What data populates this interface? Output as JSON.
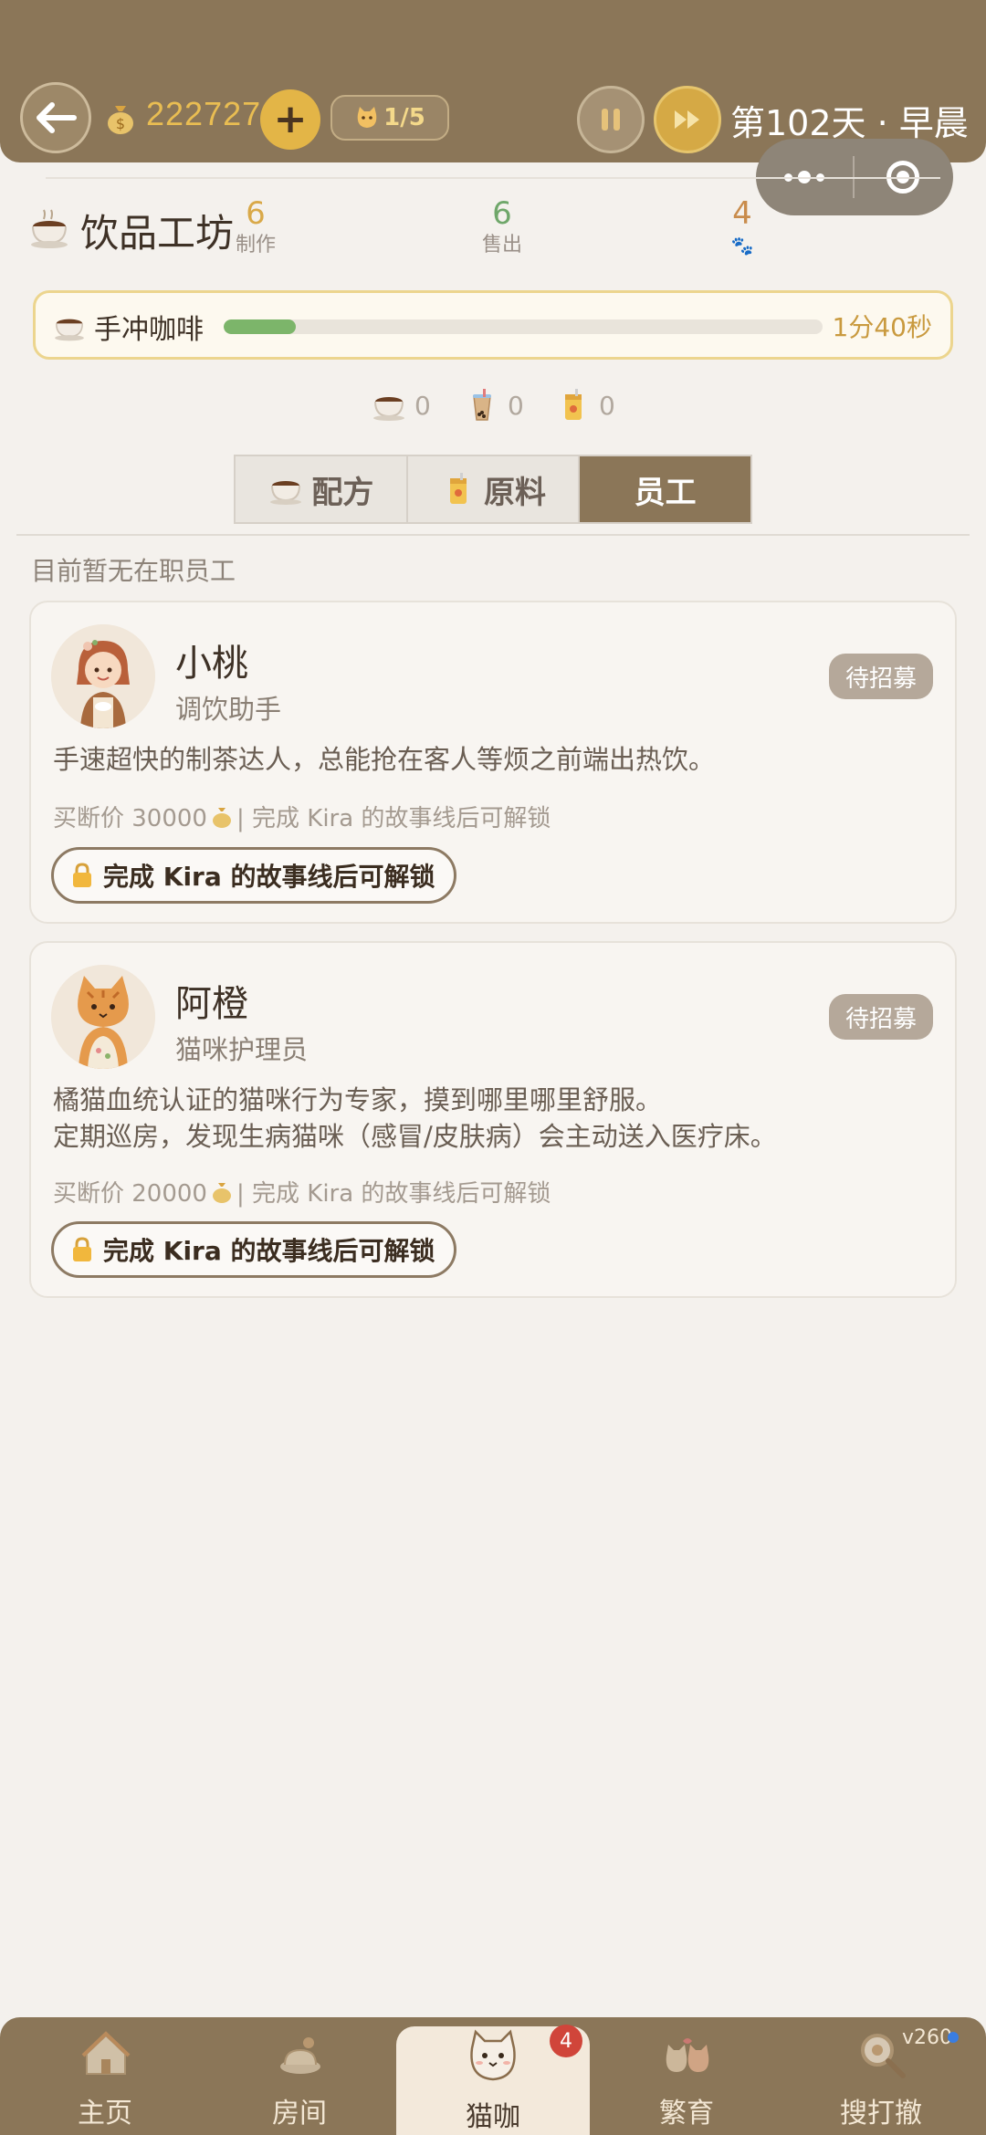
{
  "topbar": {
    "coins": "222727",
    "plus_label": "+",
    "cat_count": "1/5",
    "day_label": "第102天 · 早晨"
  },
  "workshop": {
    "title": "饮品工坊",
    "stats": [
      {
        "value": "6",
        "label": "制作"
      },
      {
        "value": "6",
        "label": "售出"
      },
      {
        "value": "4",
        "label": "🐾"
      }
    ]
  },
  "brewing": {
    "drink": "手冲咖啡",
    "progress": 0.12,
    "time_left": "1分40秒"
  },
  "inventory": [
    {
      "icon": "coffee-cup-icon",
      "count": "0"
    },
    {
      "icon": "bubble-tea-icon",
      "count": "0"
    },
    {
      "icon": "juice-can-icon",
      "count": "0"
    }
  ],
  "tabs": [
    {
      "label": "配方",
      "icon": "coffee-cup-icon",
      "active": false
    },
    {
      "label": "原料",
      "icon": "juice-can-icon",
      "active": false
    },
    {
      "label": "员工",
      "active": true
    }
  ],
  "staff_empty_note": "目前暂无在职员工",
  "staff": [
    {
      "name": "小桃",
      "role": "调饮助手",
      "status": "待招募",
      "desc_lines": [
        "手速超快的制茶达人，总能抢在客人等烦之前端出热饮。"
      ],
      "price_prefix": "买断价 30000",
      "price_suffix": "| 完成 Kira 的故事线后可解锁",
      "unlock_label": "完成 Kira 的故事线后可解锁"
    },
    {
      "name": "阿橙",
      "role": "猫咪护理员",
      "status": "待招募",
      "desc_lines": [
        "橘猫血统认证的猫咪行为专家，摸到哪里哪里舒服。",
        "定期巡房，发现生病猫咪（感冒/皮肤病）会主动送入医疗床。"
      ],
      "price_prefix": "买断价 20000",
      "price_suffix": "| 完成 Kira 的故事线后可解锁",
      "unlock_label": "完成 Kira 的故事线后可解锁"
    }
  ],
  "bottom_nav": {
    "items": [
      {
        "label": "主页",
        "icon": "house-icon"
      },
      {
        "label": "房间",
        "icon": "room-icon"
      },
      {
        "label": "猫咖",
        "icon": "cat-cup-icon",
        "active": true
      },
      {
        "label": "繁育",
        "icon": "cats-pair-icon"
      },
      {
        "label": "搜打撤",
        "icon": "magnifier-icon"
      }
    ],
    "badge": "4",
    "version": "v260"
  },
  "colors": {
    "brand_brown": "#8b7658",
    "gold": "#e3b547",
    "progress_green": "#7cb56a",
    "badge_red": "#d0453a"
  }
}
